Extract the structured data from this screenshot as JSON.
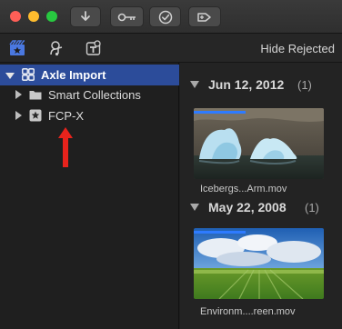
{
  "toolbar": {
    "traffic_lights": [
      "close",
      "minimize",
      "zoom"
    ],
    "buttons": [
      {
        "name": "import-button",
        "icon": "download-arrow-icon"
      },
      {
        "name": "keywords-button",
        "icon": "key-icon"
      },
      {
        "name": "background-tasks-button",
        "icon": "checkmark-circle-icon"
      },
      {
        "name": "share-button",
        "icon": "share-icon"
      }
    ]
  },
  "browser_toolbar": {
    "icons": [
      "libraries-icon",
      "photos-audio-icon",
      "titles-generators-icon"
    ],
    "filter_label": "Hide Rejected"
  },
  "sidebar": {
    "library": {
      "label": "Axle Import",
      "expanded": true,
      "selected": true
    },
    "items": [
      {
        "label": "Smart Collections",
        "icon": "folder-icon",
        "expanded": false
      },
      {
        "label": "FCP-X",
        "icon": "event-star-icon",
        "expanded": false
      }
    ]
  },
  "browser": {
    "groups": [
      {
        "date": "Jun 12, 2012",
        "count": "(1)",
        "clips": [
          {
            "name": "Icebergs...Arm.mov",
            "progress": 0.4
          }
        ]
      },
      {
        "date": "May 22, 2008",
        "count": "(1)",
        "clips": [
          {
            "name": "Environm....reen.mov",
            "progress": 0.4
          }
        ]
      }
    ]
  },
  "colors": {
    "selection": "#2c4c9a",
    "accent_blue": "#2e7bff",
    "annotation_red": "#e8231c"
  }
}
